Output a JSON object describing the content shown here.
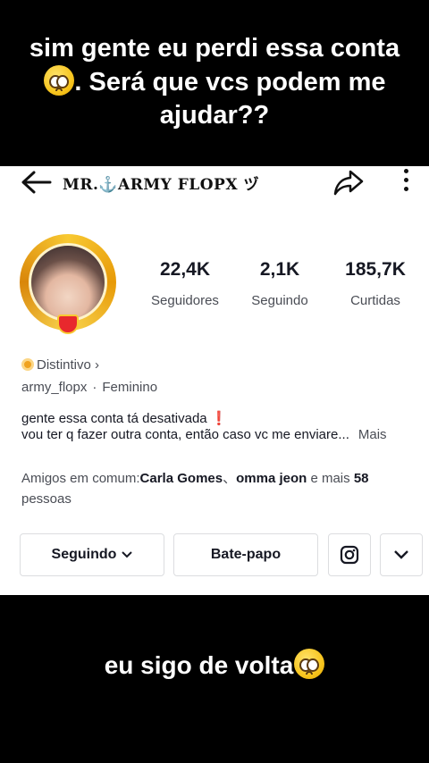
{
  "caption_top": {
    "text": "sim gente eu perdi essa conta",
    "text_after": ". Será que vcs podem me ajudar??"
  },
  "caption_bottom": {
    "text": "eu sigo de volta"
  },
  "profile": {
    "name": "MR.⚓ARMY FLOPX ヅ",
    "username": "army_flopx",
    "gender": "Feminino",
    "badge_label": "Distintivo ›",
    "separator": "·"
  },
  "stats": [
    {
      "value": "22,4K",
      "label": "Seguidores"
    },
    {
      "value": "2,1K",
      "label": "Seguindo"
    },
    {
      "value": "185,7K",
      "label": "Curtidas"
    }
  ],
  "bio": {
    "line1": "gente essa conta tá desativada",
    "line1_mark": "❗",
    "line2": "vou ter q fazer outra conta, então caso vc me enviare...",
    "more": "Mais"
  },
  "friends": {
    "prefix": "Amigos em comum:",
    "name1": "Carla Gomes",
    "sep": "、",
    "name2": "omma jeon",
    "middle": " e mais ",
    "count": "58",
    "suffix": " pessoas"
  },
  "buttons": {
    "following": "Seguindo",
    "following_chevron": "⌄",
    "chat": "Bate-papo"
  },
  "icons": {
    "back": "arrow-left-icon",
    "share": "share-arrow-icon",
    "more": "more-vertical-icon",
    "instagram": "instagram-icon",
    "dropdown": "chevron-down-icon"
  },
  "colors": {
    "accent_gold": "#f8c932",
    "warn_red": "#e2162d",
    "text": "#161823",
    "muted": "#4a4d55"
  }
}
